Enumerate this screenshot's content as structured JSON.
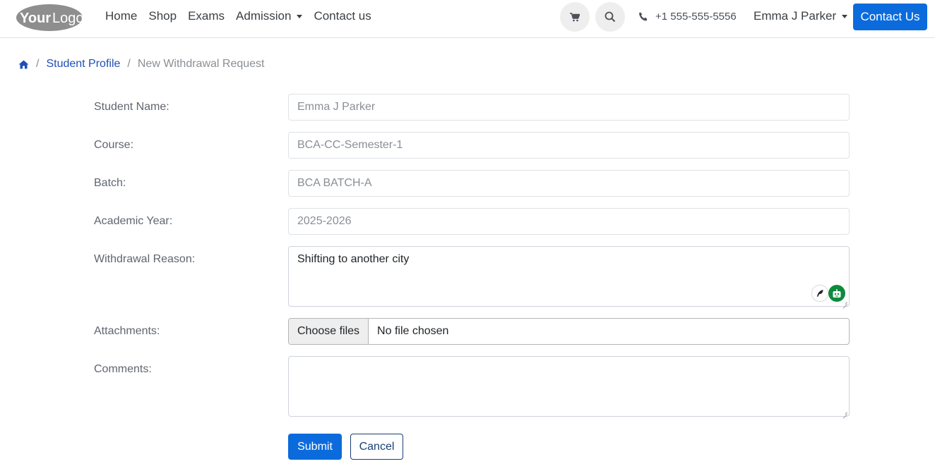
{
  "header": {
    "logo_text": "YourLogo",
    "nav": [
      {
        "label": "Home"
      },
      {
        "label": "Shop"
      },
      {
        "label": "Exams"
      },
      {
        "label": "Admission"
      },
      {
        "label": "Contact us"
      }
    ],
    "phone": "+1 555-555-5556",
    "user": "Emma J Parker",
    "contact_button": "Contact Us",
    "icons": [
      "cart-icon",
      "search-icon",
      "phone-icon"
    ]
  },
  "breadcrumb": {
    "home_icon": "home-icon",
    "items": [
      "Student Profile",
      "New Withdrawal Request"
    ]
  },
  "form": {
    "student_name": {
      "label": "Student Name:",
      "value": "Emma J Parker"
    },
    "course": {
      "label": "Course:",
      "value": "BCA-CC-Semester-1"
    },
    "batch": {
      "label": "Batch:",
      "value": "BCA BATCH-A"
    },
    "academic_year": {
      "label": "Academic Year:",
      "value": "2025-2026"
    },
    "withdrawal_reason": {
      "label": "Withdrawal Reason:",
      "value": "Shifting to another city"
    },
    "attachments": {
      "label": "Attachments:",
      "button": "Choose files",
      "status": "No file chosen"
    },
    "comments": {
      "label": "Comments:",
      "value": ""
    },
    "submit": "Submit",
    "cancel": "Cancel"
  },
  "colors": {
    "primary": "#0b6bdc",
    "link": "#1f4fb6",
    "assistant_green": "#0f8a3c"
  }
}
